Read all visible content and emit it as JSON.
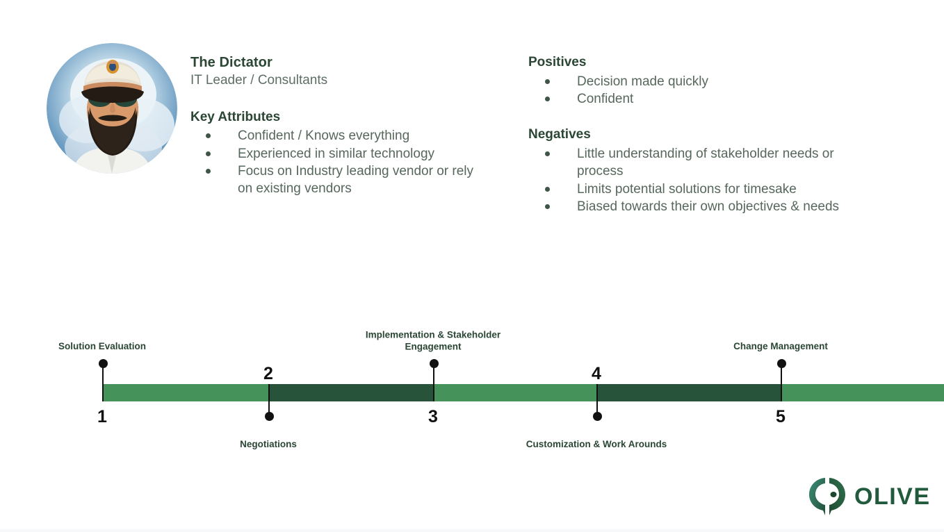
{
  "persona": {
    "avatar_name": "dictator-portrait-avatar",
    "title": "The Dictator",
    "subtitle": "IT Leader / Consultants",
    "attributes_heading": "Key Attributes",
    "attributes": [
      "Confident / Knows everything",
      "Experienced in similar technology",
      "Focus on Industry leading vendor or rely on existing vendors"
    ]
  },
  "assessment": {
    "positives_heading": "Positives",
    "positives": [
      "Decision made quickly",
      "Confident"
    ],
    "negatives_heading": "Negatives",
    "negatives": [
      "Little understanding of stakeholder needs or process",
      "Limits potential solutions for timesake",
      "Biased towards their own objectives & needs"
    ]
  },
  "timeline": {
    "steps": [
      {
        "number": "1",
        "label": "Solution Evaluation",
        "direction": "up"
      },
      {
        "number": "2",
        "label": "Negotiations",
        "direction": "down"
      },
      {
        "number": "3",
        "label": "Implementation & Stakeholder Engagement",
        "direction": "up"
      },
      {
        "number": "4",
        "label": "Customization & Work Arounds",
        "direction": "down"
      },
      {
        "number": "5",
        "label": "Change Management",
        "direction": "up"
      }
    ],
    "colors": {
      "light_green": "#45925b",
      "dark_green": "#27533a",
      "marker": "#111111",
      "label": "#2b4634"
    }
  },
  "branding": {
    "logo_mark_name": "olive-leaf-mark-icon",
    "wordmark": "OLIVE",
    "brand_color": "#215a3c"
  },
  "theme": {
    "heading_color": "#2b4634",
    "body_color": "#56675c",
    "subtitle_color": "#5d6f64",
    "background": "#ffffff"
  }
}
